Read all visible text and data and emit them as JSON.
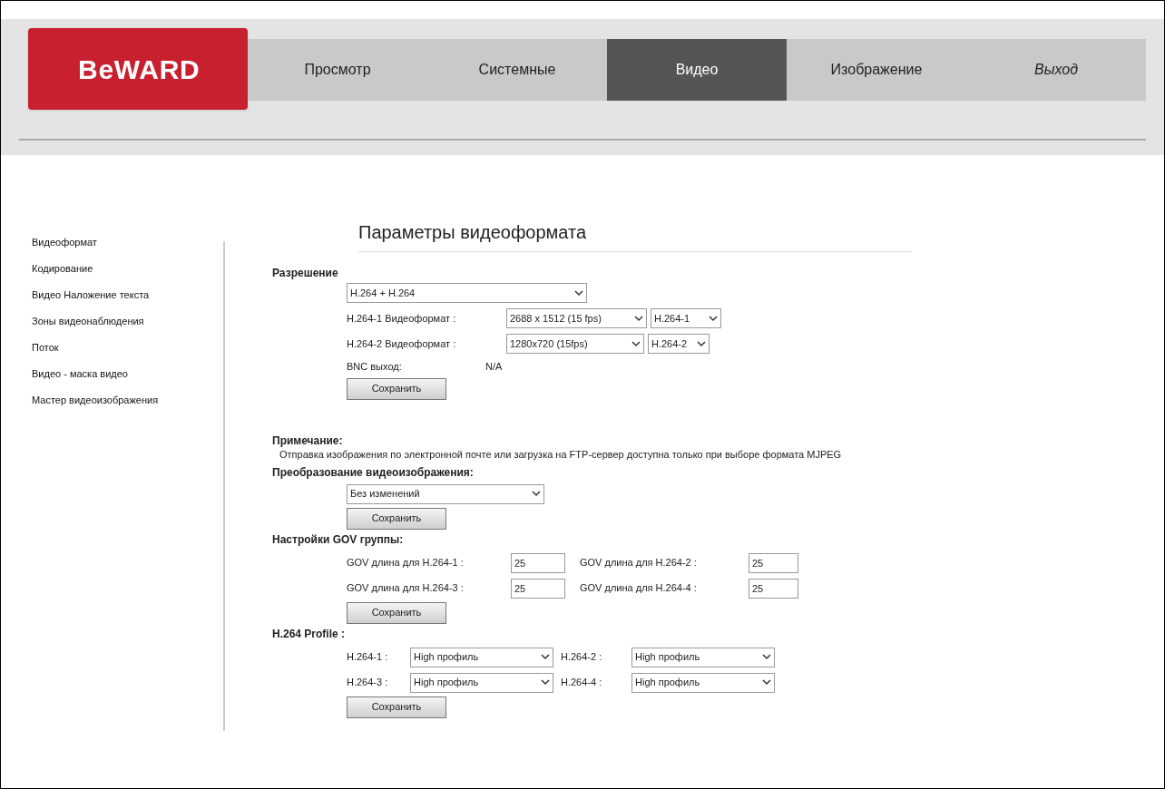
{
  "logo": {
    "text": "BeWARD"
  },
  "tabs": [
    {
      "label": "Просмотр",
      "selected": false
    },
    {
      "label": "Системные",
      "selected": false
    },
    {
      "label": "Видео",
      "selected": true
    },
    {
      "label": "Изображение",
      "selected": false
    },
    {
      "label": "Выход",
      "selected": false
    }
  ],
  "sidebar": {
    "items": [
      "Видеоформат",
      "Кодирование",
      "Видео Наложение текста",
      "Зоны видеонаблюдения",
      "Поток",
      "Видео - маска видео",
      "Мастер видеоизображения"
    ]
  },
  "title": "Параметры видеоформата",
  "resolution": {
    "heading": "Разрешение",
    "mode": "H.264 + H.264",
    "streams": [
      {
        "label": "H.264-1 Видеоформат :",
        "format": "2688 x 1512 (15 fps)",
        "stream": "H.264-1"
      },
      {
        "label": "H.264-2 Видеоформат :",
        "format": "1280x720 (15fps)",
        "stream": "H.264-2"
      }
    ],
    "bnc_label": "BNC выход:",
    "bnc_value": "N/A",
    "save": "Сохранить"
  },
  "note": {
    "heading": "Примечание:",
    "text": "Отправка изображения по электронной почте или загрузка на FTP-сервер доступна только при выборе формата MJPEG"
  },
  "transform": {
    "heading": "Преобразование видеоизображения:",
    "value": "Без изменений",
    "save": "Сохранить"
  },
  "gov": {
    "heading": "Настройки GOV группы:",
    "fields": [
      {
        "label": "GOV длина для H.264-1 :",
        "value": "25"
      },
      {
        "label": "GOV длина для H.264-2 :",
        "value": "25"
      },
      {
        "label": "GOV длина для H.264-3 :",
        "value": "25"
      },
      {
        "label": "GOV длина для H.264-4 :",
        "value": "25"
      }
    ],
    "save": "Сохранить"
  },
  "profile": {
    "heading": "H.264 Profile :",
    "fields": [
      {
        "label": "H.264-1 :",
        "value": "High профиль"
      },
      {
        "label": "H.264-2 :",
        "value": "High профиль"
      },
      {
        "label": "H.264-3 :",
        "value": "High профиль"
      },
      {
        "label": "H.264-4 :",
        "value": "High профиль"
      }
    ],
    "save": "Сохранить"
  }
}
